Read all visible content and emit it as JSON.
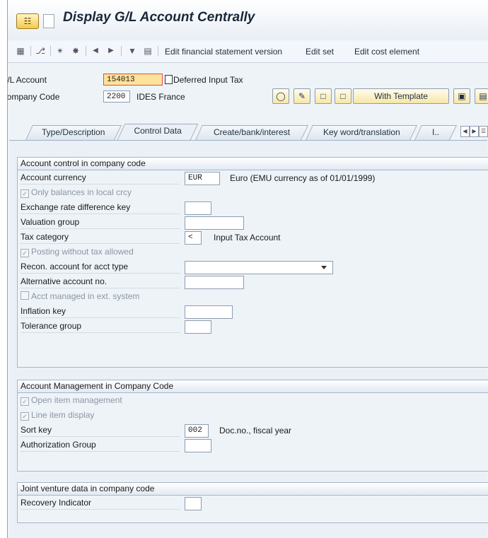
{
  "window": {
    "title": "Display G/L Account Centrally"
  },
  "toolbar": {
    "edit_fs_version": "Edit financial statement version",
    "edit_set": "Edit set",
    "edit_cost_element": "Edit cost element"
  },
  "header": {
    "gl_account_label": "G/L Account",
    "gl_account_value": "154013",
    "gl_account_desc": "Deferred Input Tax",
    "company_code_label": "Company Code",
    "company_code_value": "2200",
    "company_code_desc": "IDES France",
    "with_template_label": "With Template"
  },
  "tabs": [
    {
      "label": "Type/Description"
    },
    {
      "label": "Control Data"
    },
    {
      "label": "Create/bank/interest"
    },
    {
      "label": "Key word/translation"
    },
    {
      "label": "I.."
    }
  ],
  "group1": {
    "title": "Account control in company code",
    "account_currency_label": "Account currency",
    "account_currency_value": "EUR",
    "account_currency_desc": "Euro (EMU currency as of 01/01/1999)",
    "only_balances_label": "Only balances in local crcy",
    "exchange_rate_label": "Exchange rate difference key",
    "valuation_group_label": "Valuation group",
    "tax_category_label": "Tax category",
    "tax_category_value": "<",
    "tax_category_desc": "Input Tax Account",
    "posting_without_tax_label": "Posting without tax allowed",
    "recon_account_label": "Recon. account for acct type",
    "alt_account_label": "Alternative account no.",
    "acct_managed_label": "Acct managed in ext. system",
    "inflation_key_label": "Inflation key",
    "tolerance_group_label": "Tolerance group"
  },
  "group2": {
    "title": "Account Management in Company Code",
    "open_item_label": "Open item management",
    "line_item_label": "Line item display",
    "sort_key_label": "Sort key",
    "sort_key_value": "002",
    "sort_key_desc": "Doc.no., fiscal year",
    "auth_group_label": "Authorization Group"
  },
  "group3": {
    "title": "Joint venture data in company code",
    "recovery_label": "Recovery Indicator"
  },
  "checkboxes": {
    "only_balances": true,
    "posting_without_tax": true,
    "acct_managed": false,
    "open_item": true,
    "line_item": true
  }
}
